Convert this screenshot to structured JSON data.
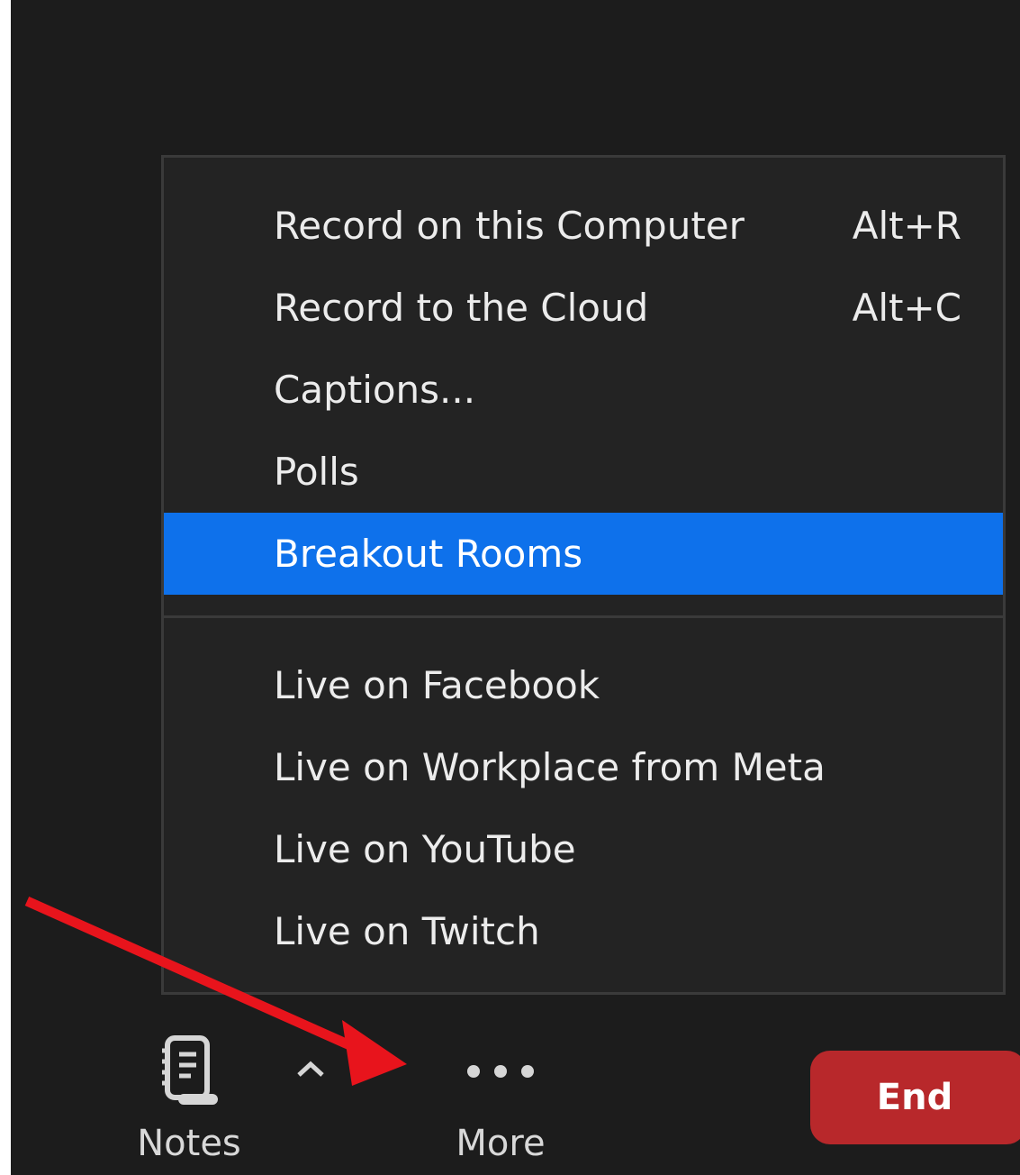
{
  "menu": {
    "items": [
      {
        "label": "Record on this Computer",
        "shortcut": "Alt+R"
      },
      {
        "label": "Record to the Cloud",
        "shortcut": "Alt+C"
      },
      {
        "label": "Captions...",
        "shortcut": ""
      },
      {
        "label": "Polls",
        "shortcut": ""
      },
      {
        "label": "Breakout Rooms",
        "shortcut": "",
        "highlighted": true
      }
    ],
    "live_items": [
      {
        "label": "Live on Facebook"
      },
      {
        "label": "Live on Workplace from Meta"
      },
      {
        "label": "Live on YouTube"
      },
      {
        "label": "Live on Twitch"
      }
    ]
  },
  "toolbar": {
    "notes_label": "Notes",
    "notes_icon": "notebook-icon",
    "chevron_icon": "chevron-up-icon",
    "more_label": "More",
    "more_icon": "ellipsis-icon",
    "end_label": "End"
  },
  "colors": {
    "background": "#1c1c1c",
    "menu_background": "#232323",
    "highlight": "#0e71eb",
    "end_button": "#b8282b",
    "annotation_arrow": "#e8141c"
  }
}
